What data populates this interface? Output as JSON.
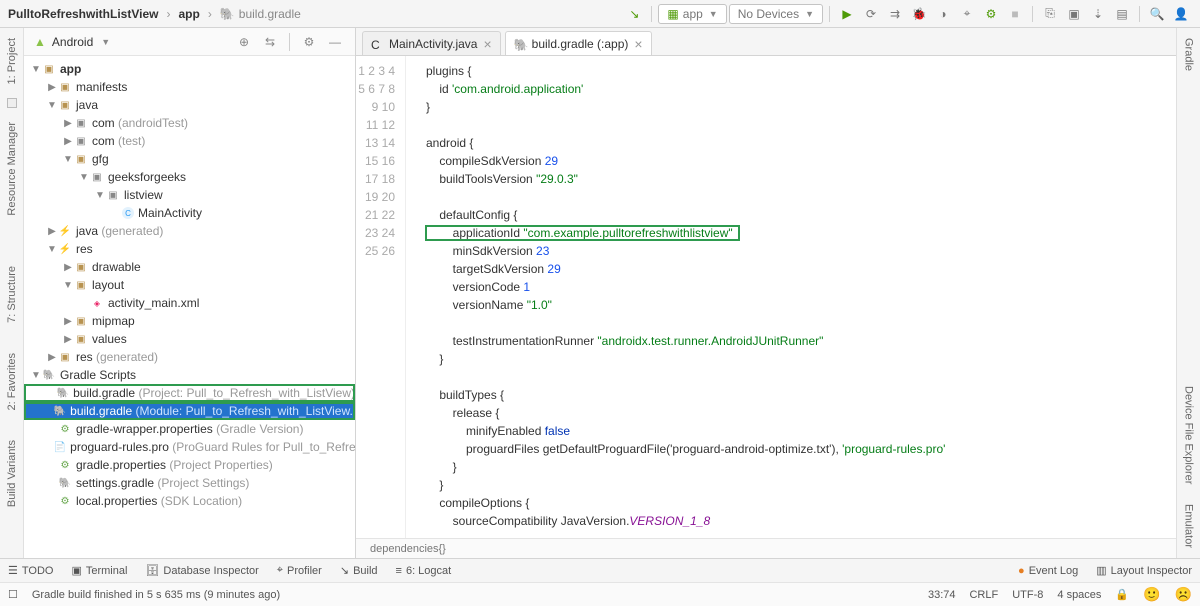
{
  "breadcrumb": {
    "project": "PulltoRefreshwithListView",
    "module": "app",
    "file": "build.gradle"
  },
  "toolbar": {
    "config": "app",
    "devices": "No Devices"
  },
  "left_tabs": {
    "project": "1: Project",
    "resource": "Resource Manager",
    "structure": "7: Structure",
    "favorites": "2: Favorites",
    "build": "Build Variants"
  },
  "right_tabs": {
    "gradle": "Gradle",
    "dfe": "Device File Explorer",
    "emulator": "Emulator"
  },
  "project_panel": {
    "title": "Android"
  },
  "tree": {
    "app": "app",
    "manifests": "manifests",
    "java": "java",
    "pkg_at": "com",
    "pkg_at_note": "(androidTest)",
    "pkg_t": "com",
    "pkg_t_note": "(test)",
    "gfg": "gfg",
    "geeks": "geeksforgeeks",
    "listview": "listview",
    "mainactivity": "MainActivity",
    "java_gen": "java",
    "java_gen_note": "(generated)",
    "res": "res",
    "drawable": "drawable",
    "layout": "layout",
    "activity_main": "activity_main.xml",
    "mipmap": "mipmap",
    "values": "values",
    "res_gen": "res",
    "res_gen_note": "(generated)",
    "gradle_scripts": "Gradle Scripts",
    "bg_proj": "build.gradle",
    "bg_proj_note": "(Project: Pull_to_Refresh_with_ListView)",
    "bg_mod": "build.gradle",
    "bg_mod_note": "(Module: Pull_to_Refresh_with_ListView.app)",
    "gwp": "gradle-wrapper.properties",
    "gwp_note": "(Gradle Version)",
    "proguard": "proguard-rules.pro",
    "proguard_note": "(ProGuard Rules for Pull_to_Refresh_w...)",
    "gp": "gradle.properties",
    "gp_note": "(Project Properties)",
    "sg": "settings.gradle",
    "sg_note": "(Project Settings)",
    "lp": "local.properties",
    "lp_note": "(SDK Location)"
  },
  "editor_tabs": {
    "tab1": "MainActivity.java",
    "tab2": "build.gradle (:app)"
  },
  "chart_data": {
    "type": "table",
    "file": "build.gradle (:app)",
    "plugins": [
      "com.android.application"
    ],
    "android": {
      "compileSdkVersion": 29,
      "buildToolsVersion": "29.0.3",
      "defaultConfig": {
        "applicationId": "com.example.pulltorefreshwithlistview",
        "minSdkVersion": 23,
        "targetSdkVersion": 29,
        "versionCode": 1,
        "versionName": "1.0",
        "testInstrumentationRunner": "androidx.test.runner.AndroidJUnitRunner"
      },
      "buildTypes": {
        "release": {
          "minifyEnabled": false,
          "proguardFiles": [
            "getDefaultProguardFile('proguard-android-optimize.txt')",
            "proguard-rules.pro"
          ]
        }
      },
      "compileOptions": {
        "sourceCompatibility": "JavaVersion.VERSION_1_8"
      }
    }
  },
  "code_crumbs": "dependencies{}",
  "bottom": {
    "todo": "TODO",
    "terminal": "Terminal",
    "db": "Database Inspector",
    "profiler": "Profiler",
    "build": "Build",
    "logcat": "6: Logcat",
    "eventlog": "Event Log",
    "layout": "Layout Inspector"
  },
  "status": {
    "msg": "Gradle build finished in 5 s 635 ms (9 minutes ago)",
    "pos": "33:74",
    "eol": "CRLF",
    "enc": "UTF-8",
    "indent": "4 spaces"
  }
}
